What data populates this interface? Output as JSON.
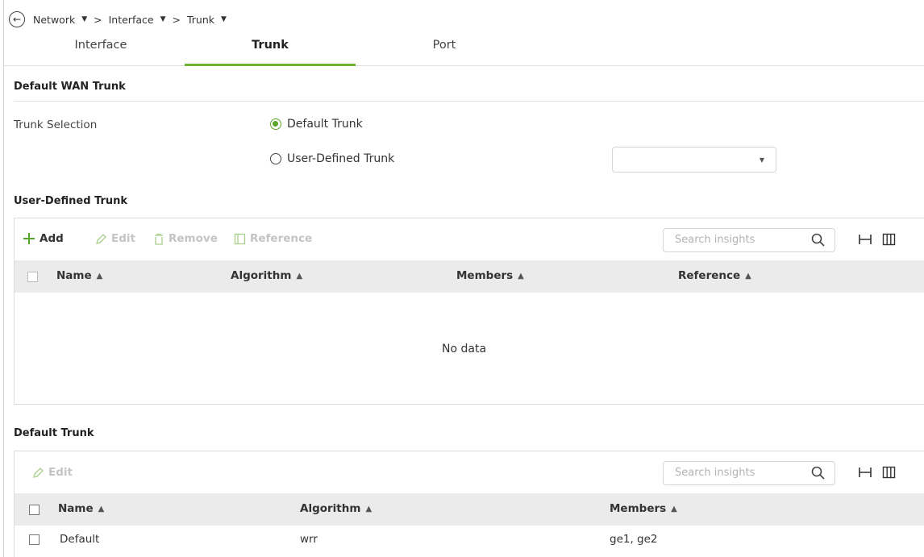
{
  "breadcrumb": {
    "items": [
      "Network",
      "Interface",
      "Trunk"
    ],
    "separator": ">"
  },
  "tabs": [
    {
      "label": "Interface",
      "active": false
    },
    {
      "label": "Trunk",
      "active": true
    },
    {
      "label": "Port",
      "active": false
    }
  ],
  "default_wan": {
    "title": "Default WAN Trunk",
    "selection_label": "Trunk Selection",
    "options": [
      {
        "label": "Default Trunk",
        "selected": true
      },
      {
        "label": "User-Defined Trunk",
        "selected": false
      }
    ],
    "dropdown_value": ""
  },
  "user_defined": {
    "title": "User-Defined Trunk",
    "toolbar": {
      "add": "Add",
      "edit": "Edit",
      "remove": "Remove",
      "reference": "Reference"
    },
    "search_placeholder": "Search insights",
    "columns": [
      "Name",
      "Algorithm",
      "Members",
      "Reference"
    ],
    "empty_text": "No data"
  },
  "default_trunk": {
    "title": "Default Trunk",
    "toolbar": {
      "edit": "Edit"
    },
    "search_placeholder": "Search insights",
    "columns": [
      "Name",
      "Algorithm",
      "Members"
    ],
    "rows": [
      {
        "name": "Default",
        "algorithm": "wrr",
        "members": "ge1, ge2"
      }
    ]
  },
  "colors": {
    "accent": "#70b334",
    "disabled": "#c4c4c4",
    "header_bg": "#ebebeb"
  }
}
